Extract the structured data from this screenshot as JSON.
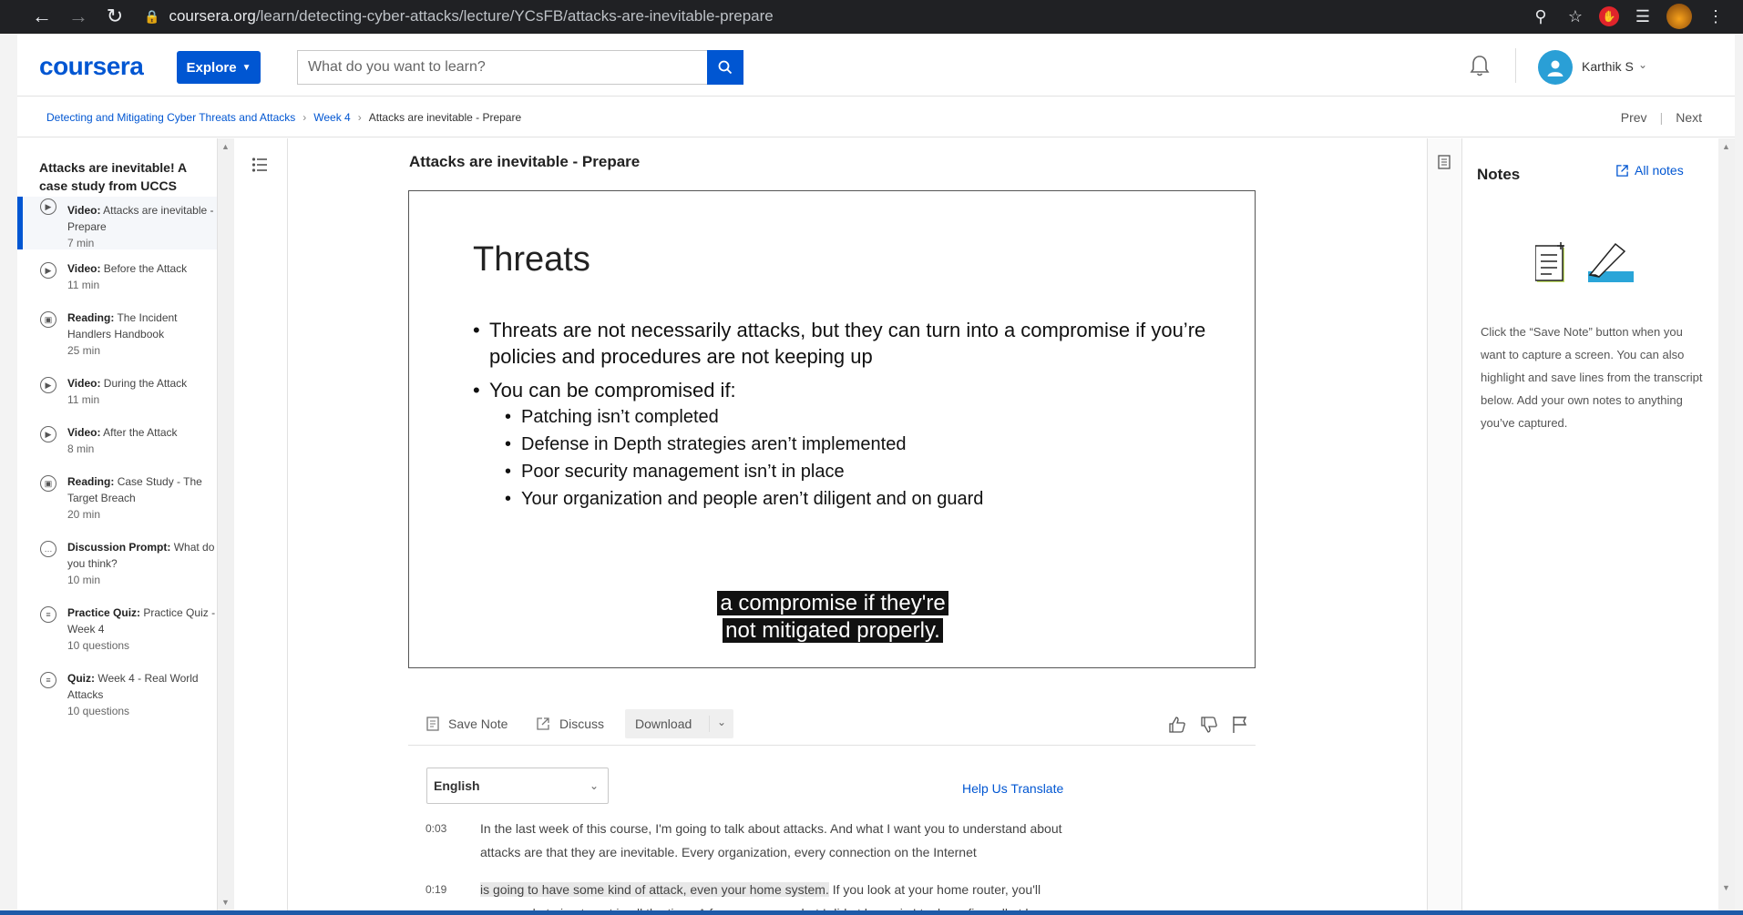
{
  "browser": {
    "url_host": "coursera.org",
    "url_path": "/learn/detecting-cyber-attacks/lecture/YCsFB/attacks-are-inevitable-prepare"
  },
  "header": {
    "logo": "coursera",
    "explore_label": "Explore",
    "search_placeholder": "What do you want to learn?",
    "user_name": "Karthik S"
  },
  "breadcrumb": {
    "items": [
      "Detecting and Mitigating Cyber Threats and Attacks",
      "Week 4",
      "Attacks are inevitable - Prepare"
    ],
    "prev": "Prev",
    "next": "Next"
  },
  "sidebar": {
    "module_title": "Attacks are inevitable! A case study from UCCS",
    "lessons": [
      {
        "type": "Video:",
        "title": "Attacks are inevitable - Prepare",
        "duration": "7 min",
        "icon": "play-icon"
      },
      {
        "type": "Video:",
        "title": "Before the Attack",
        "duration": "11 min",
        "icon": "play-icon"
      },
      {
        "type": "Reading:",
        "title": "The Incident Handlers Handbook",
        "duration": "25 min",
        "icon": "reading-icon"
      },
      {
        "type": "Video:",
        "title": "During the Attack",
        "duration": "11 min",
        "icon": "play-icon"
      },
      {
        "type": "Video:",
        "title": "After the Attack",
        "duration": "8 min",
        "icon": "play-icon"
      },
      {
        "type": "Reading:",
        "title": "Case Study - The Target Breach",
        "duration": "20 min",
        "icon": "reading-icon"
      },
      {
        "type": "Discussion Prompt:",
        "title": "What do you think?",
        "duration": "10 min",
        "icon": "discussion-icon"
      },
      {
        "type": "Practice Quiz:",
        "title": "Practice Quiz - Week 4",
        "duration": "10 questions",
        "icon": "quiz-icon"
      },
      {
        "type": "Quiz:",
        "title": "Week 4 - Real World Attacks",
        "duration": "10 questions",
        "icon": "quiz-icon"
      }
    ]
  },
  "lecture": {
    "title": "Attacks are inevitable - Prepare",
    "slide_title": "Threats",
    "bullet_1": "Threats are not necessarily attacks, but they can turn into a compromise if you’re policies and procedures are not keeping up",
    "bullet_2": "You can be compromised if:",
    "sub_bullets": [
      "Patching isn’t completed",
      "Defense in Depth strategies aren’t implemented",
      "Poor security management isn’t in place",
      "Your organization and people aren’t diligent and on guard"
    ],
    "caption_line_1": "a compromise if they're",
    "caption_line_2": "not mitigated properly."
  },
  "toolbar": {
    "save_note": "Save Note",
    "discuss": "Discuss",
    "download": "Download"
  },
  "transcript": {
    "language": "English",
    "help_translate": "Help Us Translate",
    "lines": [
      {
        "time": "0:03",
        "text": "In the last week of this course, I'm going to talk about attacks. And what I want you to understand about attacks are that they are inevitable. Every organization, every connection on the Internet"
      },
      {
        "time": "0:19",
        "highlight": "is going to have some kind of attack, even your home system.",
        "text": " If you look at your home router, you'll see people trying to get in all the time. A few years ago what I did at home is I took my firewall at home and started logging all the connections. And had a daily printout which I'll show"
      }
    ]
  },
  "notes": {
    "title": "Notes",
    "all_notes": "All notes",
    "help_text": "Click the “Save Note” button when you want to capture a screen. You can also highlight and save lines from the transcript below. Add your own notes to anything you’ve captured."
  },
  "colors": {
    "brand_blue": "#0056d2",
    "avatar_blue": "#2a9fd6"
  }
}
